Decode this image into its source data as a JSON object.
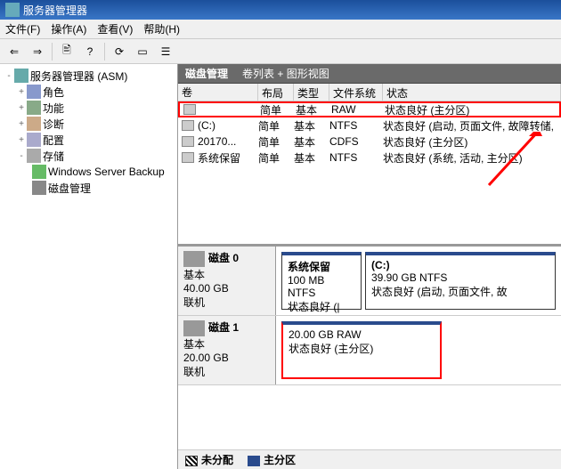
{
  "title": "服务器管理器",
  "menu": {
    "file": "文件(F)",
    "action": "操作(A)",
    "view": "查看(V)",
    "help": "帮助(H)"
  },
  "tree": {
    "root": "服务器管理器 (ASM)",
    "roles": "角色",
    "features": "功能",
    "diagnostics": "诊断",
    "config": "配置",
    "storage": "存储",
    "wsb": "Windows Server Backup",
    "diskmgmt": "磁盘管理"
  },
  "header": {
    "title": "磁盘管理",
    "subtitle": "卷列表 + 图形视图"
  },
  "cols": {
    "name": "卷",
    "layout": "布局",
    "type": "类型",
    "fs": "文件系统",
    "status": "状态"
  },
  "vols": [
    {
      "name": "",
      "layout": "简单",
      "type": "基本",
      "fs": "RAW",
      "status": "状态良好 (主分区)"
    },
    {
      "name": "(C:)",
      "layout": "简单",
      "type": "基本",
      "fs": "NTFS",
      "status": "状态良好 (启动, 页面文件, 故障转储,"
    },
    {
      "name": "20170...",
      "layout": "简单",
      "type": "基本",
      "fs": "CDFS",
      "status": "状态良好 (主分区)"
    },
    {
      "name": "系统保留",
      "layout": "简单",
      "type": "基本",
      "fs": "NTFS",
      "status": "状态良好 (系统, 活动, 主分区)"
    }
  ],
  "disks": [
    {
      "label": "磁盘 0",
      "kind": "基本",
      "size": "40.00 GB",
      "state": "联机",
      "parts": [
        {
          "title": "系统保留",
          "size": "100 MB NTFS",
          "status": "状态良好 (|"
        },
        {
          "title": "(C:)",
          "size": "39.90 GB NTFS",
          "status": "状态良好 (启动, 页面文件, 故"
        }
      ]
    },
    {
      "label": "磁盘 1",
      "kind": "基本",
      "size": "20.00 GB",
      "state": "联机",
      "parts": [
        {
          "title": "",
          "size": "20.00 GB RAW",
          "status": "状态良好 (主分区)"
        }
      ]
    }
  ],
  "legend": {
    "unalloc": "未分配",
    "primary": "主分区"
  }
}
